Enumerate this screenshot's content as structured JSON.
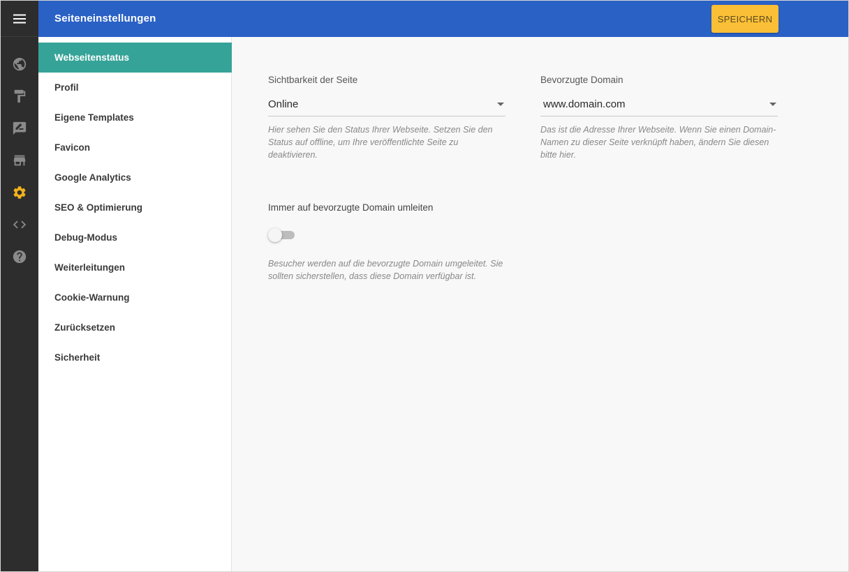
{
  "header": {
    "title": "Seiteneinstellungen",
    "save_label": "SPEICHERN"
  },
  "rail": {
    "icons": [
      "menu-icon",
      "globe-icon",
      "paint-roller-icon",
      "edit-box-icon",
      "store-icon",
      "gear-icon",
      "code-icon",
      "help-icon"
    ],
    "active": "gear-icon"
  },
  "nav": {
    "items": [
      {
        "label": "Webseitenstatus"
      },
      {
        "label": "Profil"
      },
      {
        "label": "Eigene Templates"
      },
      {
        "label": "Favicon"
      },
      {
        "label": "Google Analytics"
      },
      {
        "label": "SEO & Optimierung"
      },
      {
        "label": "Debug-Modus"
      },
      {
        "label": "Weiterleitungen"
      },
      {
        "label": "Cookie-Warnung"
      },
      {
        "label": "Zurücksetzen"
      },
      {
        "label": "Sicherheit"
      }
    ],
    "active": "Webseitenstatus"
  },
  "main": {
    "visibility": {
      "label": "Sichtbarkeit der Seite",
      "value": "Online",
      "hint": "Hier sehen Sie den Status Ihrer Webseite. Setzen Sie den Status auf offline, um Ihre veröffentlichte Seite zu deaktivieren."
    },
    "domain": {
      "label": "Bevorzugte Domain",
      "value": "www.domain.com",
      "hint": "Das ist die Adresse Ihrer Webseite. Wenn Sie einen Domain-Namen zu dieser Seite verknüpft haben, ändern Sie diesen bitte hier."
    },
    "redirect": {
      "label": "Immer auf bevorzugte Domain umleiten",
      "enabled": false,
      "hint": "Besucher werden auf die bevorzugte Domain umgeleitet. Sie sollten sicherstellen, dass diese Domain verfügbar ist."
    }
  },
  "colors": {
    "header": "#2a61c5",
    "rail": "#2d2d2d",
    "active_nav": "#36a398",
    "save_button": "#fbbf37",
    "active_icon": "#f2b21b"
  }
}
